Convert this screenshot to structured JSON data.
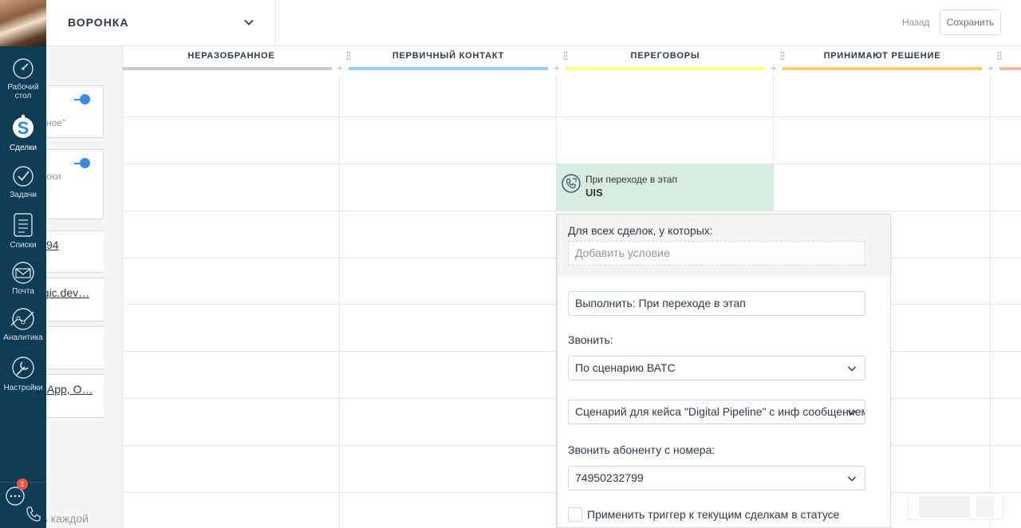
{
  "nav": {
    "items": [
      {
        "label_l1": "Рабочий",
        "label_l2": "стол",
        "icon": "dashboard-icon"
      },
      {
        "label_l1": "Сделки",
        "label_l2": "",
        "icon": "leads-icon"
      },
      {
        "label_l1": "Задачи",
        "label_l2": "",
        "icon": "tasks-icon"
      },
      {
        "label_l1": "Списки",
        "label_l2": "",
        "icon": "lists-icon"
      },
      {
        "label_l1": "Почта",
        "label_l2": "",
        "icon": "mail-icon"
      },
      {
        "label_l1": "Аналитика",
        "label_l2": "",
        "icon": "analytics-icon"
      },
      {
        "label_l1": "Настройки",
        "label_l2": "",
        "icon": "settings-icon"
      }
    ],
    "chat_badge": "1"
  },
  "header": {
    "pipeline_name": "ВОРОНКА",
    "back": "Назад",
    "save": "Сохранить"
  },
  "left_panel": {
    "card1_text": "ное\"",
    "card2_text": "оки",
    "link1": "94",
    "link2": "agic.dev…",
    "link3": "tsApp, O…",
    "bottom_text": "ть каждой"
  },
  "board": {
    "columns": [
      {
        "title": "НЕРАЗОБРАННОЕ",
        "color": "#c7cbcd"
      },
      {
        "title": "ПЕРВИЧНЫЙ КОНТАКТ",
        "color": "#99ccfd"
      },
      {
        "title": "ПЕРЕГОВОРЫ",
        "color": "#fffd7f"
      },
      {
        "title": "ПРИНИМАЮТ РЕШЕНИЕ",
        "color": "#ffcc66"
      }
    ],
    "trigger": {
      "line1": "При переходе в этап",
      "line2": "UIS"
    }
  },
  "popup": {
    "for_all": "Для всех сделок, у которых:",
    "add_condition": "Добавить условие",
    "execute": "Выполнить: При переходе в этап",
    "call_label": "Звонить:",
    "call_mode": "По сценарию ВАТС",
    "scenario": "Сценарий для кейса \"Digital Pipeline\" с инф сообщением",
    "from_number_label": "Звонить абоненту с номера:",
    "from_number": "74950232799",
    "apply_existing": "Применить триггер к текущим сделкам в статусе"
  }
}
